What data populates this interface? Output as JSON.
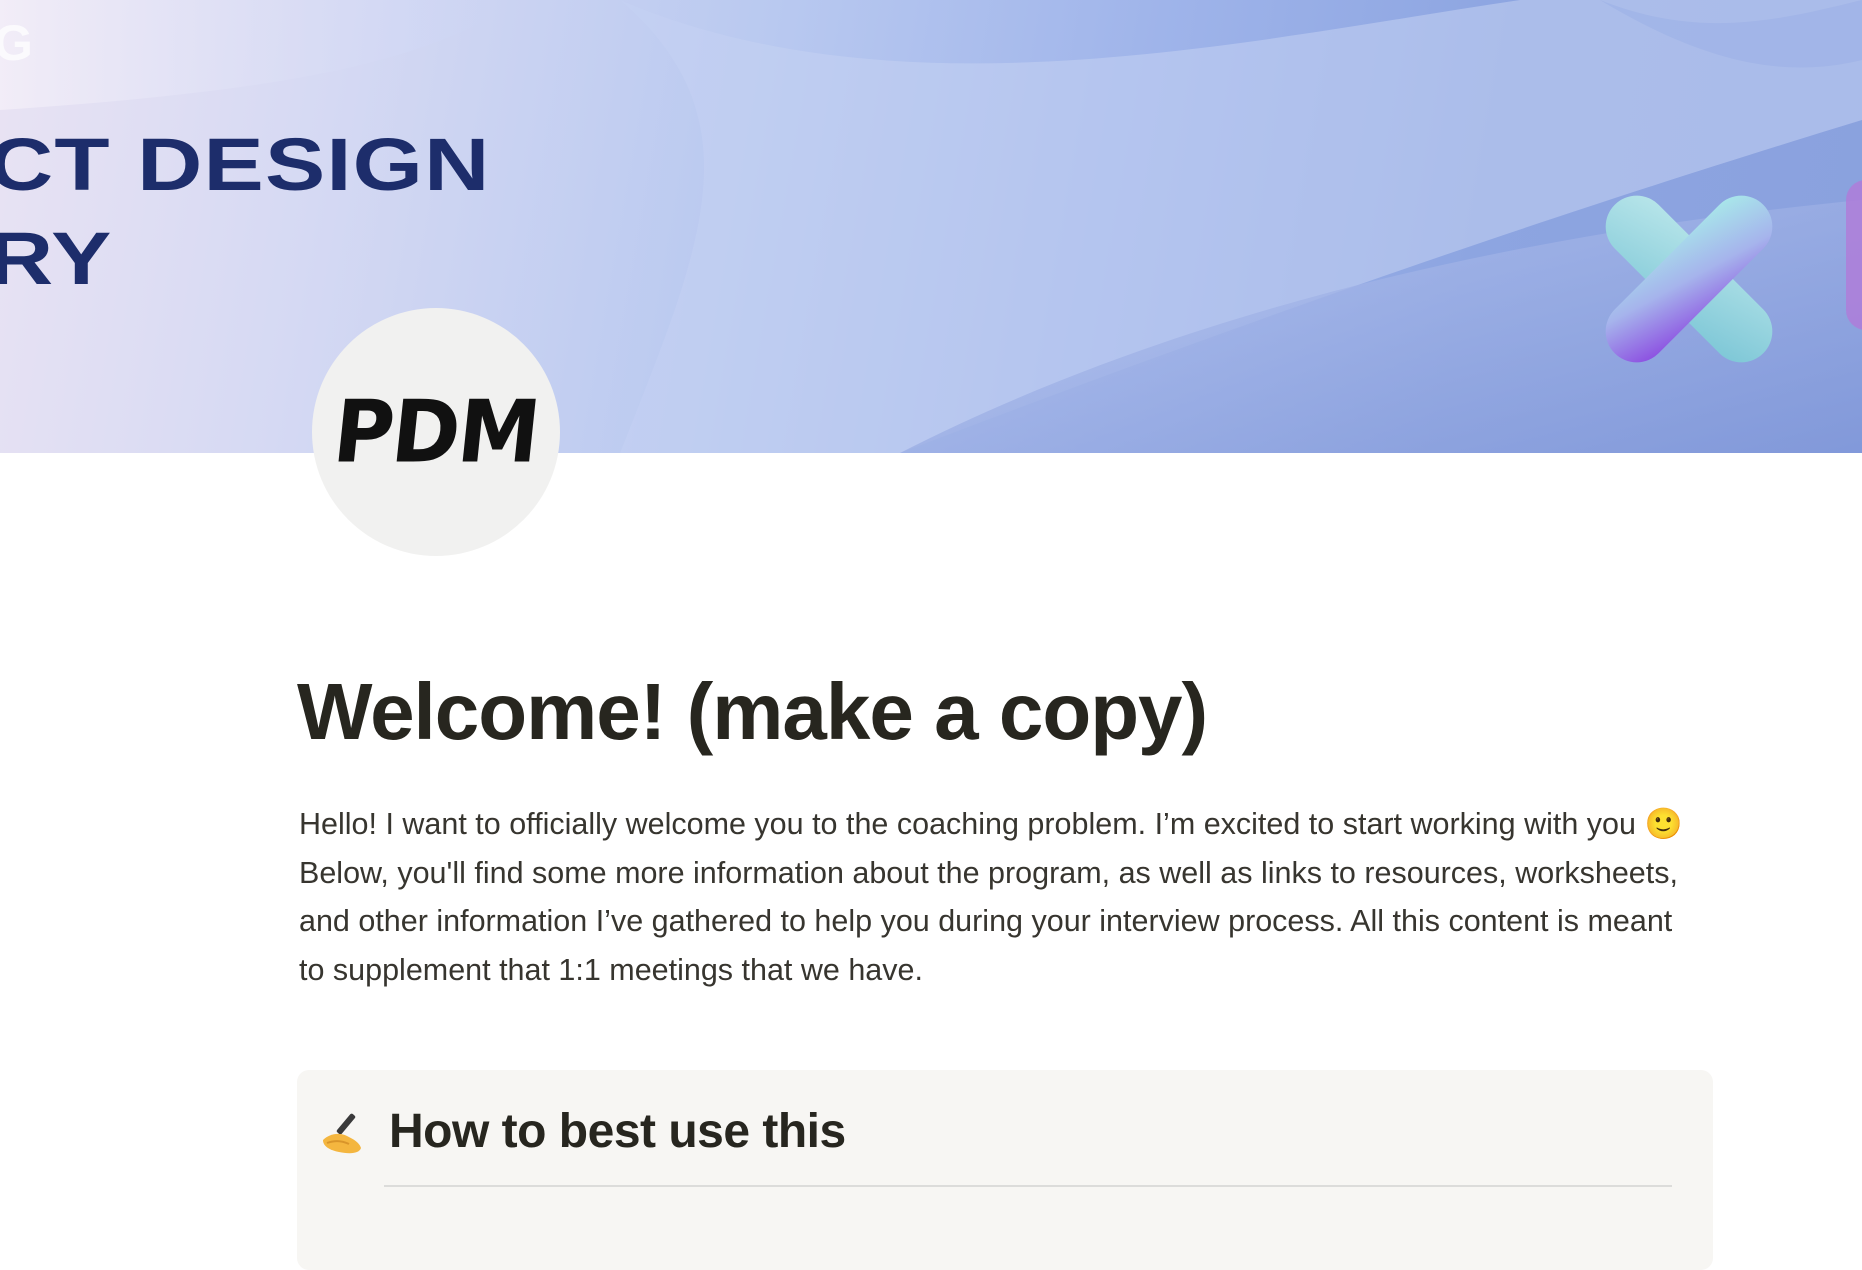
{
  "cover": {
    "line1": "G",
    "line2": "CT DESIGN",
    "line3": "RY"
  },
  "page_icon": {
    "text": "PDM"
  },
  "page": {
    "title": "Welcome! (make a copy)",
    "intro_part1": "Hello! I want to officially welcome you to the coaching problem. I’m excited to start working with you ",
    "intro_emoji": "🙂",
    "intro_part2": " Below, you'll find some more information about the program, as well as links to resources, worksheets, and other information I’ve gathered to help you during your interview process. All this content is meant to supplement that 1:1 meetings that we have."
  },
  "callout": {
    "icon": "writing-hand-icon",
    "title": "How to best use this"
  },
  "colors": {
    "title_text": "#27261f",
    "body_text": "#37352f",
    "cover_text": "#1d2d6b",
    "callout_bg": "#f7f6f3"
  }
}
